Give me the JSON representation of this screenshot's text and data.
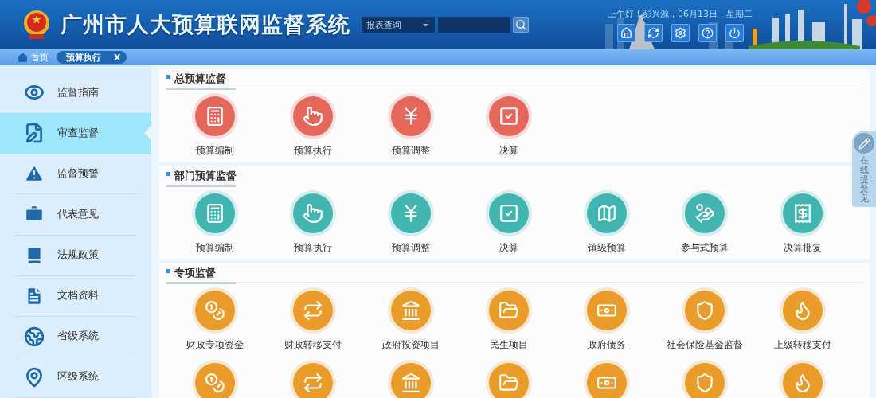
{
  "header": {
    "title": "广州市人大预算联网监督系统",
    "search": {
      "select": "报表查询"
    },
    "greeting": "上午好！彭兴源，06月13日，星期二"
  },
  "breadcrumbs": {
    "home": "首页",
    "tabs": [
      {
        "label": "预算执行",
        "selected": true,
        "close": "X"
      }
    ]
  },
  "sidebar": {
    "items": [
      {
        "label": "监督指南",
        "selected": false
      },
      {
        "label": "审查监督",
        "selected": true
      },
      {
        "label": "监督预警",
        "selected": false
      },
      {
        "label": "代表意见",
        "selected": false
      },
      {
        "label": "法规政策",
        "selected": false
      },
      {
        "label": "文档资料",
        "selected": false
      },
      {
        "label": "省级系统",
        "selected": false
      },
      {
        "label": "区级系统",
        "selected": false
      }
    ]
  },
  "sections": [
    {
      "title": "总预算监督",
      "color": "#e5675c",
      "items": [
        {
          "kind": "tile",
          "label": "预算编制"
        },
        {
          "kind": "tile",
          "label": "预算执行"
        },
        {
          "kind": "tile",
          "label": "预算调整"
        },
        {
          "kind": "tile",
          "label": "决算"
        }
      ]
    },
    {
      "title": "部门预算监督",
      "color": "#41b5b0",
      "items": [
        {
          "kind": "tile",
          "label": "预算编制"
        },
        {
          "kind": "tile",
          "label": "预算执行"
        },
        {
          "kind": "tile",
          "label": "预算调整"
        },
        {
          "kind": "tile",
          "label": "决算"
        },
        {
          "kind": "tile",
          "label": "镇级预算"
        },
        {
          "kind": "tile",
          "label": "参与式预算"
        },
        {
          "kind": "tile",
          "label": "决算批复"
        }
      ]
    },
    {
      "title": "专项监督",
      "color": "#e99c2a",
      "items": [
        {
          "kind": "tile",
          "label": "财政专项资金"
        },
        {
          "kind": "tile",
          "label": "财政转移支付"
        },
        {
          "kind": "tile",
          "label": "政府投资项目"
        },
        {
          "kind": "tile",
          "label": "民生项目"
        },
        {
          "kind": "tile",
          "label": "政府债务"
        },
        {
          "kind": "tile",
          "label": "社会保险基金监督"
        },
        {
          "kind": "tile",
          "label": "上级转移支付"
        },
        {
          "kind": "partial"
        },
        {
          "kind": "partial"
        },
        {
          "kind": "partial"
        },
        {
          "kind": "partial"
        },
        {
          "kind": "partial"
        },
        {
          "kind": "partial"
        },
        {
          "kind": "partial"
        }
      ]
    }
  ],
  "feedback": {
    "label": "在线提意见"
  }
}
